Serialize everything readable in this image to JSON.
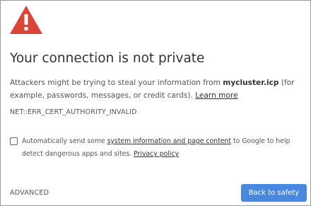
{
  "interstitial": {
    "icon": "warning-triangle-icon",
    "accent_color": "#db4437",
    "heading": "Your connection is not private",
    "description": {
      "before_host": "Attackers might be trying to steal your information from ",
      "host": "mycluster.icp",
      "after_host": " (for example, passwords, messages, or credit cards). ",
      "learn_more": "Learn more"
    },
    "error_code": "NET::ERR_CERT_AUTHORITY_INVALID",
    "optin": {
      "checked": false,
      "before_link": "Automatically send some ",
      "link_text": "system information and page content",
      "after_link": " to Google to help detect dangerous apps and sites. ",
      "privacy_link": "Privacy policy"
    },
    "advanced_label": "ADVANCED",
    "back_button_label": "Back to safety",
    "button_color": "#4a88e0"
  }
}
